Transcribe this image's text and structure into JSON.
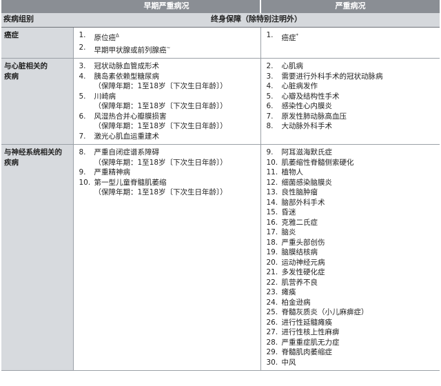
{
  "header": {
    "early_title": "早期严重病况",
    "severe_title": "严重病况",
    "group_label": "疾病组别",
    "lifetime_label": "终身保障（除特别注明外）"
  },
  "sections": [
    {
      "category": [
        "癌症"
      ],
      "early": [
        {
          "num": "1.",
          "text": "原位癌",
          "mark": "Δ"
        },
        {
          "num": "2.",
          "text": "早期甲状腺或前列腺癌",
          "mark": "~"
        }
      ],
      "severe": [
        {
          "num": "1.",
          "text": "癌症",
          "mark": "*"
        }
      ]
    },
    {
      "category": [
        "与心脏相关的",
        "疾病"
      ],
      "early": [
        {
          "num": "3.",
          "text": "冠状动脉血管成形术"
        },
        {
          "num": "4.",
          "text": "胰岛素依赖型糖尿病",
          "sub": "（保障年期：1至18岁〔下次生日年龄〕）"
        },
        {
          "num": "5.",
          "text": "川崎病",
          "sub": "（保障年期：1至18岁〔下次生日年龄〕）"
        },
        {
          "num": "6.",
          "text": "风湿热合并心瓣膜损害",
          "sub": "（保障年期：1至18岁〔下次生日年龄〕）"
        },
        {
          "num": "7.",
          "text": "激光心肌血运重建术"
        }
      ],
      "severe": [
        {
          "num": "2.",
          "text": "心肌病"
        },
        {
          "num": "3.",
          "text": "需要进行外科手术的冠状动脉病"
        },
        {
          "num": "4.",
          "text": "心脏病发作"
        },
        {
          "num": "5.",
          "text": "心瓣及结构性手术"
        },
        {
          "num": "6.",
          "text": "感染性心内膜炎"
        },
        {
          "num": "7.",
          "text": "原发性肺动脉高血压"
        },
        {
          "num": "8.",
          "text": "大动脉外科手术"
        }
      ]
    },
    {
      "category": [
        "与神经系统相关的",
        "疾病"
      ],
      "early": [
        {
          "num": "8.",
          "text": "严重自闭症谱系障碍",
          "sub": "（保障年期：1至18岁〔下次生日年龄〕）"
        },
        {
          "num": "9.",
          "text": "严重精神病"
        },
        {
          "num": "10.",
          "text": "第一型儿童脊髓肌萎缩",
          "sub": "（保障年期：1至18岁〔下次生日年龄〕）"
        }
      ],
      "severe": [
        {
          "num": "9.",
          "text": "阿耳滋海默氏症"
        },
        {
          "num": "10.",
          "text": "肌萎缩性脊髓侧索硬化"
        },
        {
          "num": "11.",
          "text": "植物人"
        },
        {
          "num": "12.",
          "text": "细菌感染脑膜炎"
        },
        {
          "num": "13.",
          "text": "良性脑肿瘤"
        },
        {
          "num": "14.",
          "text": "脑部外科手术"
        },
        {
          "num": "15.",
          "text": "昏迷"
        },
        {
          "num": "16.",
          "text": "克雅二氏症"
        },
        {
          "num": "17.",
          "text": "脑炎"
        },
        {
          "num": "18.",
          "text": "严重头部创伤"
        },
        {
          "num": "19.",
          "text": "脑膜结核病"
        },
        {
          "num": "20.",
          "text": "运动神经元病"
        },
        {
          "num": "21.",
          "text": "多发性硬化症"
        },
        {
          "num": "22.",
          "text": "肌营养不良"
        },
        {
          "num": "23.",
          "text": "瘫痪"
        },
        {
          "num": "24.",
          "text": "柏金逊病"
        },
        {
          "num": "25.",
          "text": "脊髓灰质炎（小儿麻痹症）"
        },
        {
          "num": "26.",
          "text": "进行性延髓瘫痪"
        },
        {
          "num": "27.",
          "text": "进行性核上性麻痹"
        },
        {
          "num": "28.",
          "text": "严重重症肌无力症"
        },
        {
          "num": "29.",
          "text": "脊髓肌肉萎缩症"
        },
        {
          "num": "30.",
          "text": "中风"
        }
      ]
    }
  ]
}
